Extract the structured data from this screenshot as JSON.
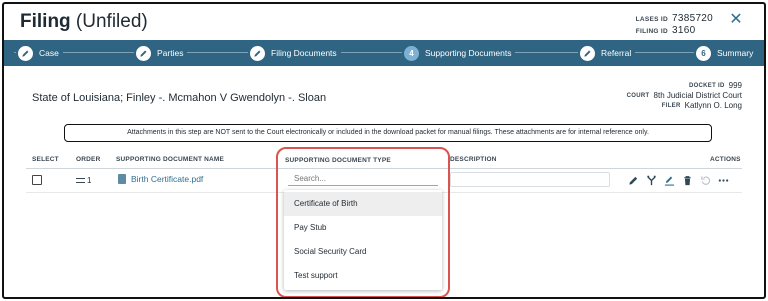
{
  "header": {
    "title_bold": "Filing",
    "title_rest": " (Unfiled)",
    "lases_id_label": "LASES ID",
    "lases_id": "7385720",
    "filing_id_label": "FILING ID",
    "filing_id": "3160",
    "close_icon": "close-icon"
  },
  "steps": [
    {
      "label": "Case",
      "marker": "",
      "icon": "pencil-icon",
      "active": false
    },
    {
      "label": "Parties",
      "marker": "",
      "icon": "pencil-icon",
      "active": false
    },
    {
      "label": "Filing Documents",
      "marker": "",
      "icon": "pencil-icon",
      "active": false
    },
    {
      "label": "Supporting Documents",
      "marker": "4",
      "icon": "",
      "active": true
    },
    {
      "label": "Referral",
      "marker": "",
      "icon": "pencil-icon",
      "active": false
    },
    {
      "label": "Summary",
      "marker": "6",
      "icon": "",
      "active": false
    }
  ],
  "case": {
    "title": "State of Louisiana; Finley -. Mcmahon V Gwendolyn -. Sloan",
    "docket_label": "DOCKET ID",
    "docket_id": "999",
    "court_label": "COURT",
    "court": "8th Judicial District Court",
    "filer_label": "FILER",
    "filer": "Katlynn O. Long"
  },
  "notice": "Attachments in this step are NOT sent to the Court electronically or included in the download packet for manual filings. These attachments are for internal reference only.",
  "table": {
    "headers": {
      "select": "SELECT",
      "order": "ORDER",
      "name": "SUPPORTING DOCUMENT NAME",
      "type": "SUPPORTING DOCUMENT TYPE",
      "description": "DESCRIPTION",
      "actions": "ACTIONS"
    },
    "rows": [
      {
        "order": "1",
        "name": "Birth Certificate.pdf",
        "description": ""
      }
    ],
    "actions": [
      "edit-icon",
      "split-icon",
      "rename-icon",
      "delete-icon",
      "undo-icon",
      "more-icon"
    ]
  },
  "type_dropdown": {
    "placeholder": "Search...",
    "options": [
      "Certificate of Birth",
      "Pay Stub",
      "Social Security Card",
      "Test support"
    ],
    "highlighted_index": 0
  },
  "colors": {
    "stepper_bg": "#2f6582",
    "active_step": "#7cb1d4",
    "link": "#2f6f91",
    "focus_outline": "#d9534f"
  }
}
